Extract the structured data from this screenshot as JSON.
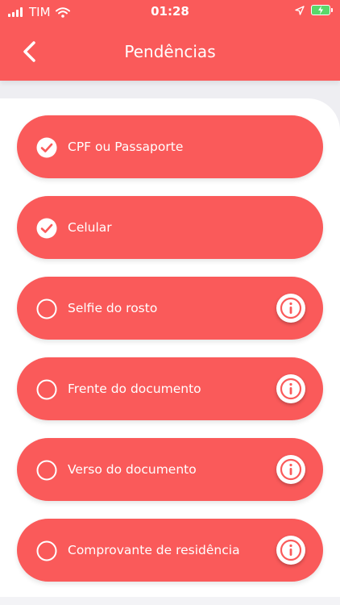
{
  "status_bar": {
    "carrier": "TIM",
    "time": "01:28"
  },
  "header": {
    "title": "Pendências"
  },
  "colors": {
    "accent": "#fa5a5a",
    "background": "#eeeef2"
  },
  "items": [
    {
      "label": "CPF ou Passaporte",
      "completed": true,
      "has_info": false
    },
    {
      "label": "Celular",
      "completed": true,
      "has_info": false
    },
    {
      "label": "Selfie do rosto",
      "completed": false,
      "has_info": true
    },
    {
      "label": "Frente do documento",
      "completed": false,
      "has_info": true
    },
    {
      "label": "Verso do documento",
      "completed": false,
      "has_info": true
    },
    {
      "label": "Comprovante de residência",
      "completed": false,
      "has_info": true
    }
  ]
}
